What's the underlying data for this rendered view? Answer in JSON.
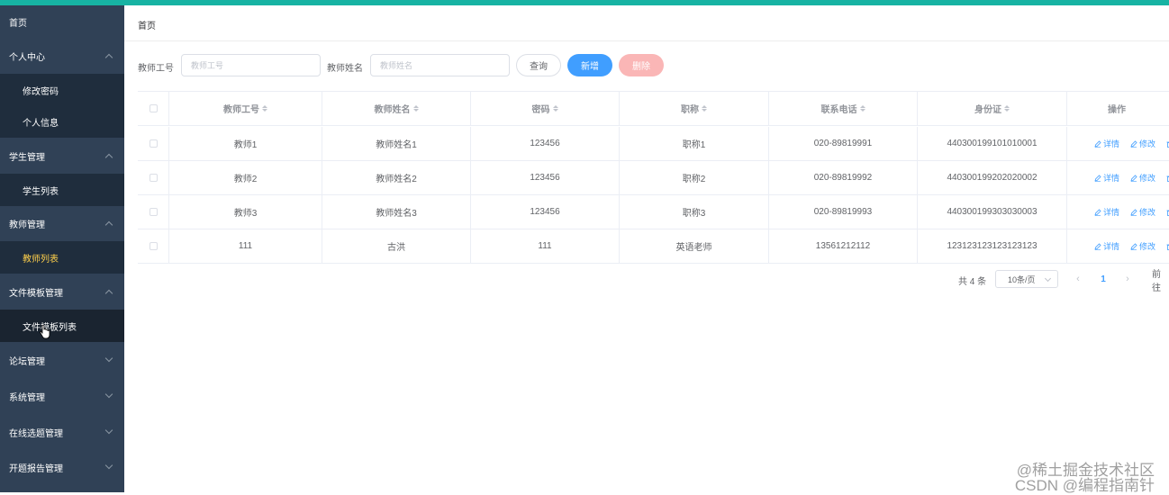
{
  "sidebar": {
    "items": [
      {
        "label": "首页",
        "type": "top"
      },
      {
        "label": "个人中心",
        "type": "group",
        "expanded": true
      },
      {
        "label": "修改密码",
        "type": "sub"
      },
      {
        "label": "个人信息",
        "type": "sub"
      },
      {
        "label": "学生管理",
        "type": "group",
        "expanded": true
      },
      {
        "label": "学生列表",
        "type": "sub"
      },
      {
        "label": "教师管理",
        "type": "group",
        "expanded": true
      },
      {
        "label": "教师列表",
        "type": "sub",
        "active": true
      },
      {
        "label": "文件模板管理",
        "type": "group",
        "expanded": true
      },
      {
        "label": "文件模板列表",
        "type": "sub",
        "hover": true
      },
      {
        "label": "论坛管理",
        "type": "group",
        "expanded": false
      },
      {
        "label": "系统管理",
        "type": "group",
        "expanded": false
      },
      {
        "label": "在线选题管理",
        "type": "group",
        "expanded": false
      },
      {
        "label": "开题报告管理",
        "type": "group",
        "expanded": false
      }
    ],
    "active_color": "#ffd04b",
    "bg_color": "#304156"
  },
  "breadcrumb": "首页",
  "search": {
    "id_label": "教师工号",
    "id_placeholder": "教师工号",
    "name_label": "教师姓名",
    "name_placeholder": "教师姓名",
    "query_button": "查询",
    "add_button": "新增",
    "delete_button": "删除"
  },
  "table": {
    "headers": [
      "教师工号",
      "教师姓名",
      "密码",
      "职称",
      "联系电话",
      "身份证",
      "操作"
    ],
    "rows": [
      [
        "教师1",
        "教师姓名1",
        "123456",
        "职称1",
        "020-89819991",
        "440300199101010001"
      ],
      [
        "教师2",
        "教师姓名2",
        "123456",
        "职称2",
        "020-89819992",
        "440300199202020002"
      ],
      [
        "教师3",
        "教师姓名3",
        "123456",
        "职称3",
        "020-89819993",
        "440300199303030003"
      ],
      [
        "111",
        "古洪",
        "111",
        "英语老师",
        "13561212112",
        "123123123123123123"
      ]
    ],
    "actions": [
      "详情",
      "修改"
    ]
  },
  "pagination": {
    "total_text": "共 4 条",
    "page_size": "10条/页",
    "current_page": "1",
    "goto_text": "前往"
  },
  "watermark": {
    "line1": "@稀土掘金技术社区",
    "line2": "CSDN @编程指南针"
  }
}
